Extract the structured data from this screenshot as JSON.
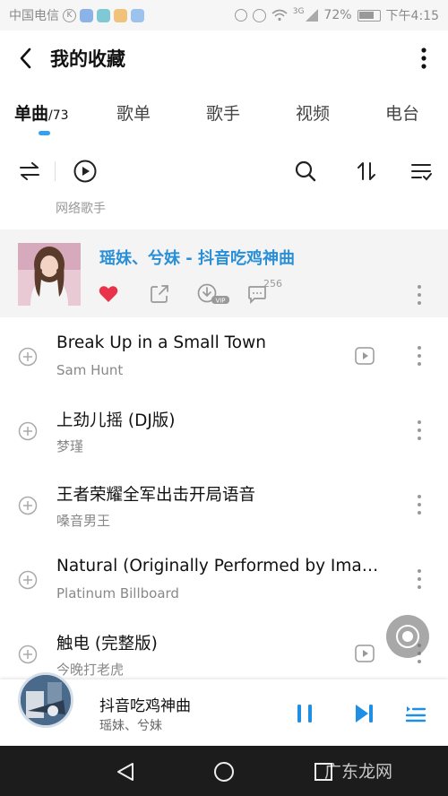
{
  "status_bar": {
    "carrier": "中国电信",
    "signal": "3G",
    "battery": "72%",
    "time": "下午4:15",
    "icons": [
      "k-icon",
      "app-icon-blue",
      "app-icon-teal",
      "app-icon-orange",
      "app-icon-k-blue",
      "data-icon",
      "alarm-icon",
      "wifi-icon",
      "signal-icon",
      "battery-icon"
    ]
  },
  "header": {
    "title": "我的收藏"
  },
  "tabs": [
    {
      "label": "单曲",
      "count": "/73",
      "active": true
    },
    {
      "label": "歌单"
    },
    {
      "label": "歌手"
    },
    {
      "label": "视频"
    },
    {
      "label": "电台"
    }
  ],
  "toolbar": {
    "icons": [
      "shuffle-icon",
      "play-all-icon",
      "search-icon",
      "sort-icon",
      "multi-select-icon"
    ]
  },
  "partial_row": {
    "artist": "网络歌手"
  },
  "playing": {
    "title": "瑶妹、兮妹 - 抖音吃鸡神曲",
    "comment_count": "256",
    "accent": "#2a8fd6",
    "liked_color": "#e8334a"
  },
  "songs": [
    {
      "title": "Break Up in a Small Town",
      "artist": "Sam Hunt",
      "has_mv": true
    },
    {
      "title": "上劲儿摇 (DJ版)",
      "artist": "梦瑾",
      "has_mv": false
    },
    {
      "title": "王者荣耀全军出击开局语音",
      "artist": "嗓音男王",
      "has_mv": false
    },
    {
      "title": "Natural (Originally Performed by Imagi...",
      "artist": "Platinum Billboard",
      "has_mv": false
    },
    {
      "title": "触电 (完整版)",
      "artist": "今晚打老虎",
      "has_mv": true
    }
  ],
  "player": {
    "title": "抖音吃鸡神曲",
    "artist": "瑶妹、兮妹",
    "accent": "#1f8fe6"
  },
  "watermark": "广东龙网"
}
